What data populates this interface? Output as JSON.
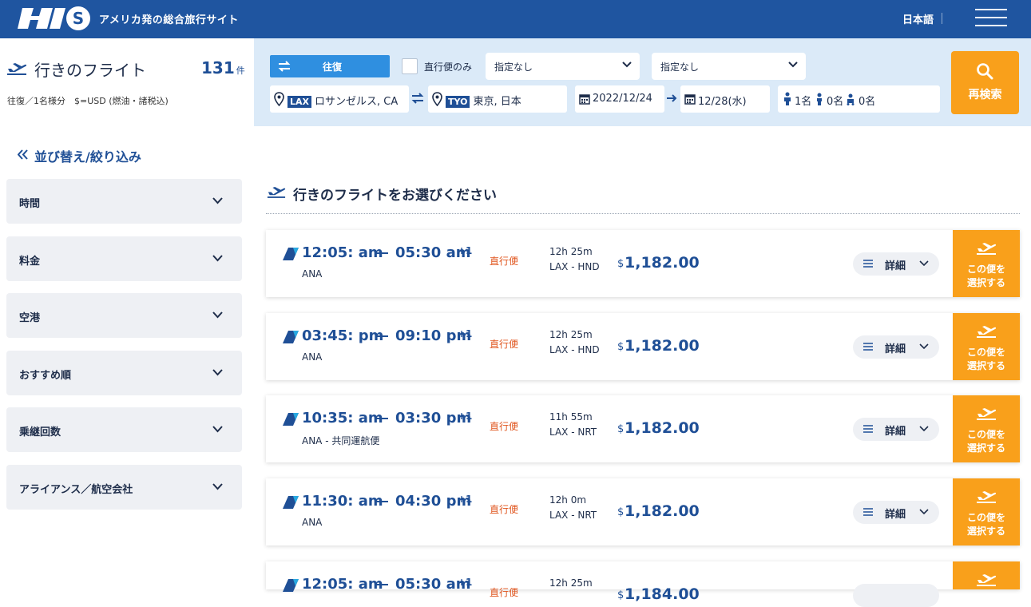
{
  "header": {
    "logo_text": "HIS",
    "tagline": "アメリカ発の総合旅行サイト",
    "language": "日本語"
  },
  "summary": {
    "title": "行きのフライト",
    "count": "131",
    "count_unit": "件",
    "note": "往復／1名様分　$=USD (燃油・諸税込)"
  },
  "search": {
    "trip_type": "往復",
    "nonstop_label": "直行便のみ",
    "nonstop_checked": false,
    "select1": "指定なし",
    "select2": "指定なし",
    "origin_code": "LAX",
    "origin_name": "ロサンゼルス, CA",
    "dest_code": "TYO",
    "dest_name": "東京, 日本",
    "depart_date": "2022/12/24",
    "return_date": "12/28(水)",
    "adults": "1名",
    "children": "0名",
    "infants": "0名",
    "button_label": "再検索"
  },
  "filters": {
    "heading": "並び替え/絞り込み",
    "items": [
      {
        "label": "時間"
      },
      {
        "label": "料金"
      },
      {
        "label": "空港"
      },
      {
        "label": "おすすめ順"
      },
      {
        "label": "乗継回数"
      },
      {
        "label": "アライアンス／航空会社"
      }
    ]
  },
  "results": {
    "title": "行きのフライトをお選びください",
    "detail_label": "詳細",
    "select_label_1": "この便を",
    "select_label_2": "選択する",
    "currency_symbol": "$",
    "flights": [
      {
        "dep": "12:05: am",
        "arr": "05:30 am",
        "plus": "+1",
        "airline": "ANA",
        "type": "直行便",
        "duration": "12h 25m",
        "route": "LAX - HND",
        "price": "1,182.00"
      },
      {
        "dep": "03:45: pm",
        "arr": "09:10 pm",
        "plus": "+1",
        "airline": "ANA",
        "type": "直行便",
        "duration": "12h 25m",
        "route": "LAX - HND",
        "price": "1,182.00"
      },
      {
        "dep": "10:35: am",
        "arr": "03:30 pm",
        "plus": "+1",
        "airline": "ANA - 共同運航便",
        "type": "直行便",
        "duration": "11h 55m",
        "route": "LAX - NRT",
        "price": "1,182.00"
      },
      {
        "dep": "11:30: am",
        "arr": "04:30 pm",
        "plus": "+1",
        "airline": "ANA",
        "type": "直行便",
        "duration": "12h 0m",
        "route": "LAX - NRT",
        "price": "1,182.00"
      },
      {
        "dep": "12:05: am",
        "arr": "05:30 am",
        "plus": "+1",
        "airline": "",
        "type": "直行便",
        "duration": "12h 25m",
        "route": "",
        "price": "1,184.00"
      }
    ]
  },
  "colors": {
    "header_bg": "#1f55a0",
    "accent_blue": "#1f4f96",
    "action_orange": "#f9a01b",
    "search_bg": "#dbeaf8",
    "nonstop_red": "#e0561f"
  }
}
